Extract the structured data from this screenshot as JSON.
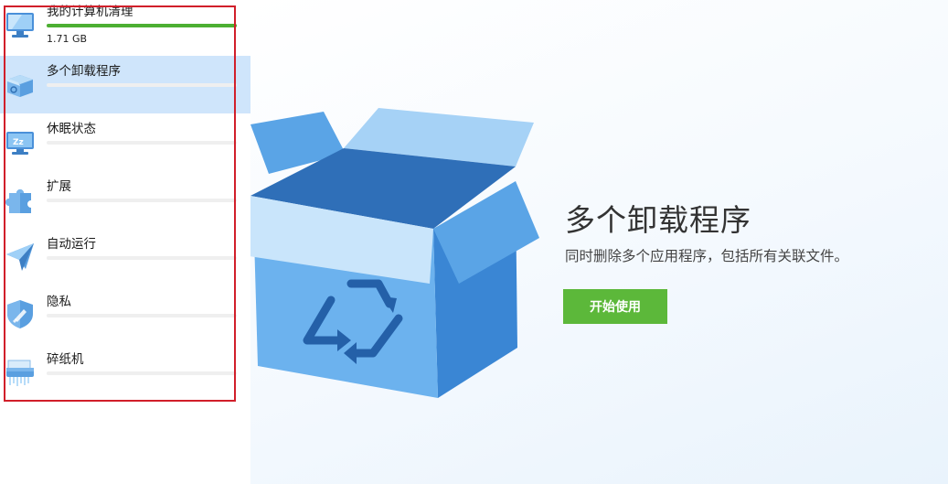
{
  "sidebar": {
    "items": [
      {
        "label": "我的计算机清理",
        "size": "1.71 GB",
        "progress": 1.0,
        "icon": "computer-icon"
      },
      {
        "label": "多个卸载程序",
        "icon": "box-icon",
        "selected": true
      },
      {
        "label": "休眠状态",
        "icon": "sleep-monitor-icon"
      },
      {
        "label": "扩展",
        "icon": "puzzle-icon"
      },
      {
        "label": "自动运行",
        "icon": "paper-plane-icon"
      },
      {
        "label": "隐私",
        "icon": "shield-icon"
      },
      {
        "label": "碎纸机",
        "icon": "shredder-icon"
      }
    ]
  },
  "main": {
    "title": "多个卸载程序",
    "description": "同时删除多个应用程序，包括所有关联文件。",
    "cta_label": "开始使用",
    "hero_icon": "recycle-box-icon"
  },
  "colors": {
    "accent_green": "#5cb83a",
    "selection_bg": "#cfe5fb",
    "highlight_border": "#d11f2a",
    "icon_blue": "#4a90d9"
  }
}
